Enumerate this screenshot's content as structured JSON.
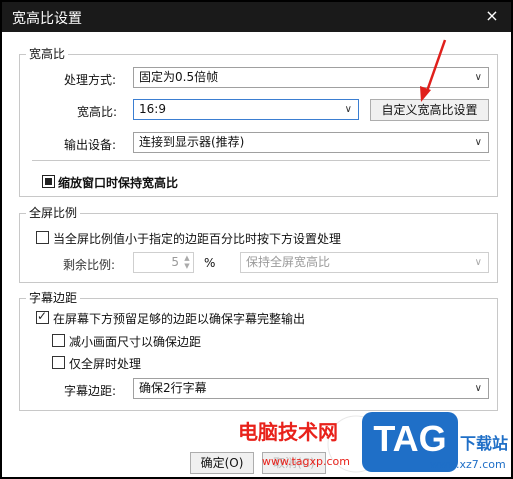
{
  "window": {
    "title": "宽高比设置",
    "close_glyph": "×"
  },
  "aspect_group": {
    "legend": "宽高比",
    "method_label": "处理方式:",
    "method_value": "固定为0.5倍帧",
    "ratio_label": "宽高比:",
    "ratio_value": "16:9",
    "custom_button": "自定义宽高比设置",
    "output_label": "输出设备:",
    "output_value": "连接到显示器(推荐)",
    "keep_ratio_label": "缩放窗口时保持宽高比",
    "keep_ratio_checked": true
  },
  "fullscreen_group": {
    "legend": "全屏比例",
    "checkbox_label": "当全屏比例值小于指定的边距百分比时按下方设置处理",
    "checkbox_checked": false,
    "remain_label": "剩余比例:",
    "remain_value": "5",
    "percent": "%",
    "mode_value": "保持全屏宽高比"
  },
  "subtitle_group": {
    "legend": "字幕边距",
    "reserve_label": "在屏幕下方预留足够的边距以确保字幕完整输出",
    "reserve_checked": true,
    "shrink_label": "减小画面尺寸以确保边距",
    "shrink_checked": false,
    "fullscreen_only_label": "仅全屏时处理",
    "fullscreen_only_checked": false,
    "margin_label": "字幕边距:",
    "margin_value": "确保2行字幕"
  },
  "footer": {
    "ok": "确定(O)",
    "cancel": "取消(C)"
  },
  "watermark": {
    "cn_text": "电脑技术网",
    "url": "www.tagxp.com",
    "badge": "TAG",
    "site_text": "下载站",
    "site_url": "www.xz7.com"
  },
  "colors": {
    "titlebar": "#1a1a1a",
    "arrow": "#e0201c",
    "watermark_red": "#e8221b",
    "badge_blue": "#1f6fc7"
  }
}
